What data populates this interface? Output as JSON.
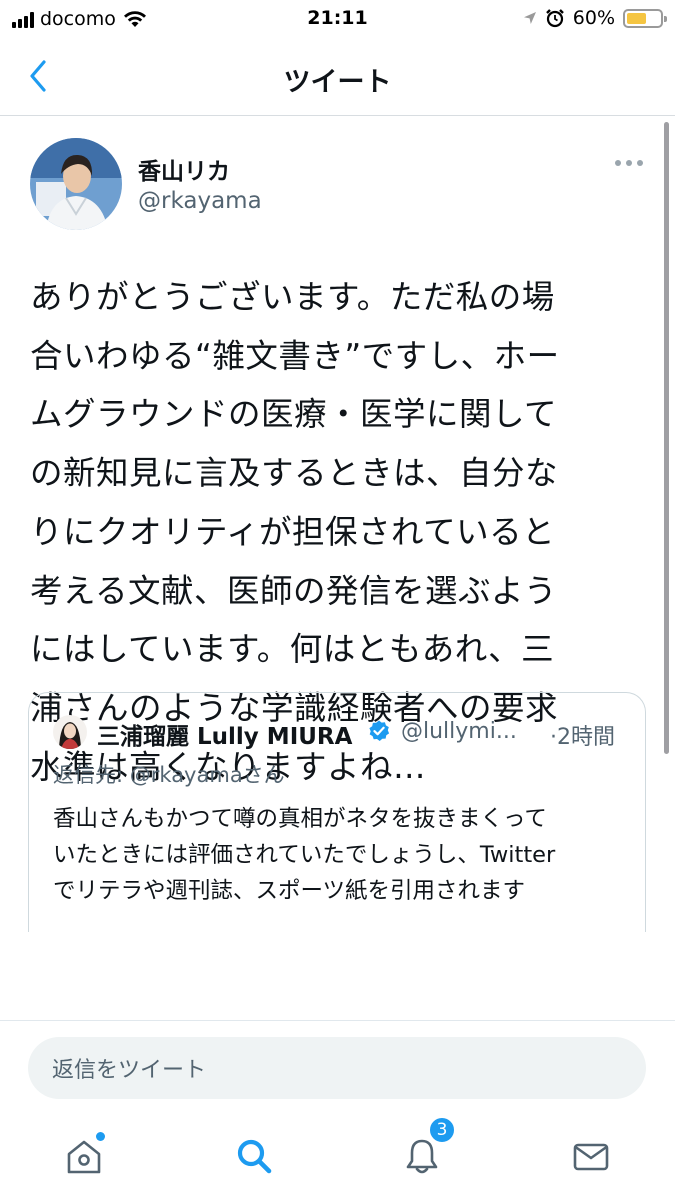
{
  "status_bar": {
    "carrier": "docomo",
    "time": "21:11",
    "battery_percent": "60%",
    "battery_level": 0.6,
    "icons": [
      "signal-icon",
      "wifi-icon",
      "location-icon",
      "alarm-icon",
      "battery-icon"
    ]
  },
  "header": {
    "title": "ツイート",
    "back_icon": "chevron-left-icon"
  },
  "tweet": {
    "author_name": "香山リカ",
    "author_handle": "@rkayama",
    "text": "ありがとうございます。ただ私の場\n合いわゆる“雑文書き”ですし、ホー\nムグラウンドの医療・医学に関して\nの新知見に言及するときは、自分な\nりにクオリティが担保されていると\n考える文献、医師の発信を選ぶよう\nにはしています。何はともあれ、三\n浦さんのような学識経験者への要求\n水準は高くなりますよね…"
  },
  "quote": {
    "author_name": "三浦瑠麗 Lully MIURA",
    "handle": "@lullymi...",
    "time": "·2時間",
    "reply_prefix": "返信先: ",
    "reply_mention": "@rkayamaさん",
    "text": "香山さんもかつて噂の真相がネタを抜きまくって\nいたときには評価されていたでしょうし、Twitter\nでリテラや週刊誌、スポーツ紙を引用されます"
  },
  "composer": {
    "placeholder": "返信をツイート"
  },
  "tabbar": {
    "items": [
      {
        "icon": "home-icon",
        "label": "home"
      },
      {
        "icon": "search-icon",
        "label": "search"
      },
      {
        "icon": "bell-icon",
        "label": "notifications"
      },
      {
        "icon": "mail-icon",
        "label": "messages"
      }
    ],
    "notification_count": "3"
  },
  "colors": {
    "accent": "#1d9bf0",
    "text": "#0f1419",
    "secondary_text": "#536471",
    "battery_fill": "#f5c542"
  }
}
